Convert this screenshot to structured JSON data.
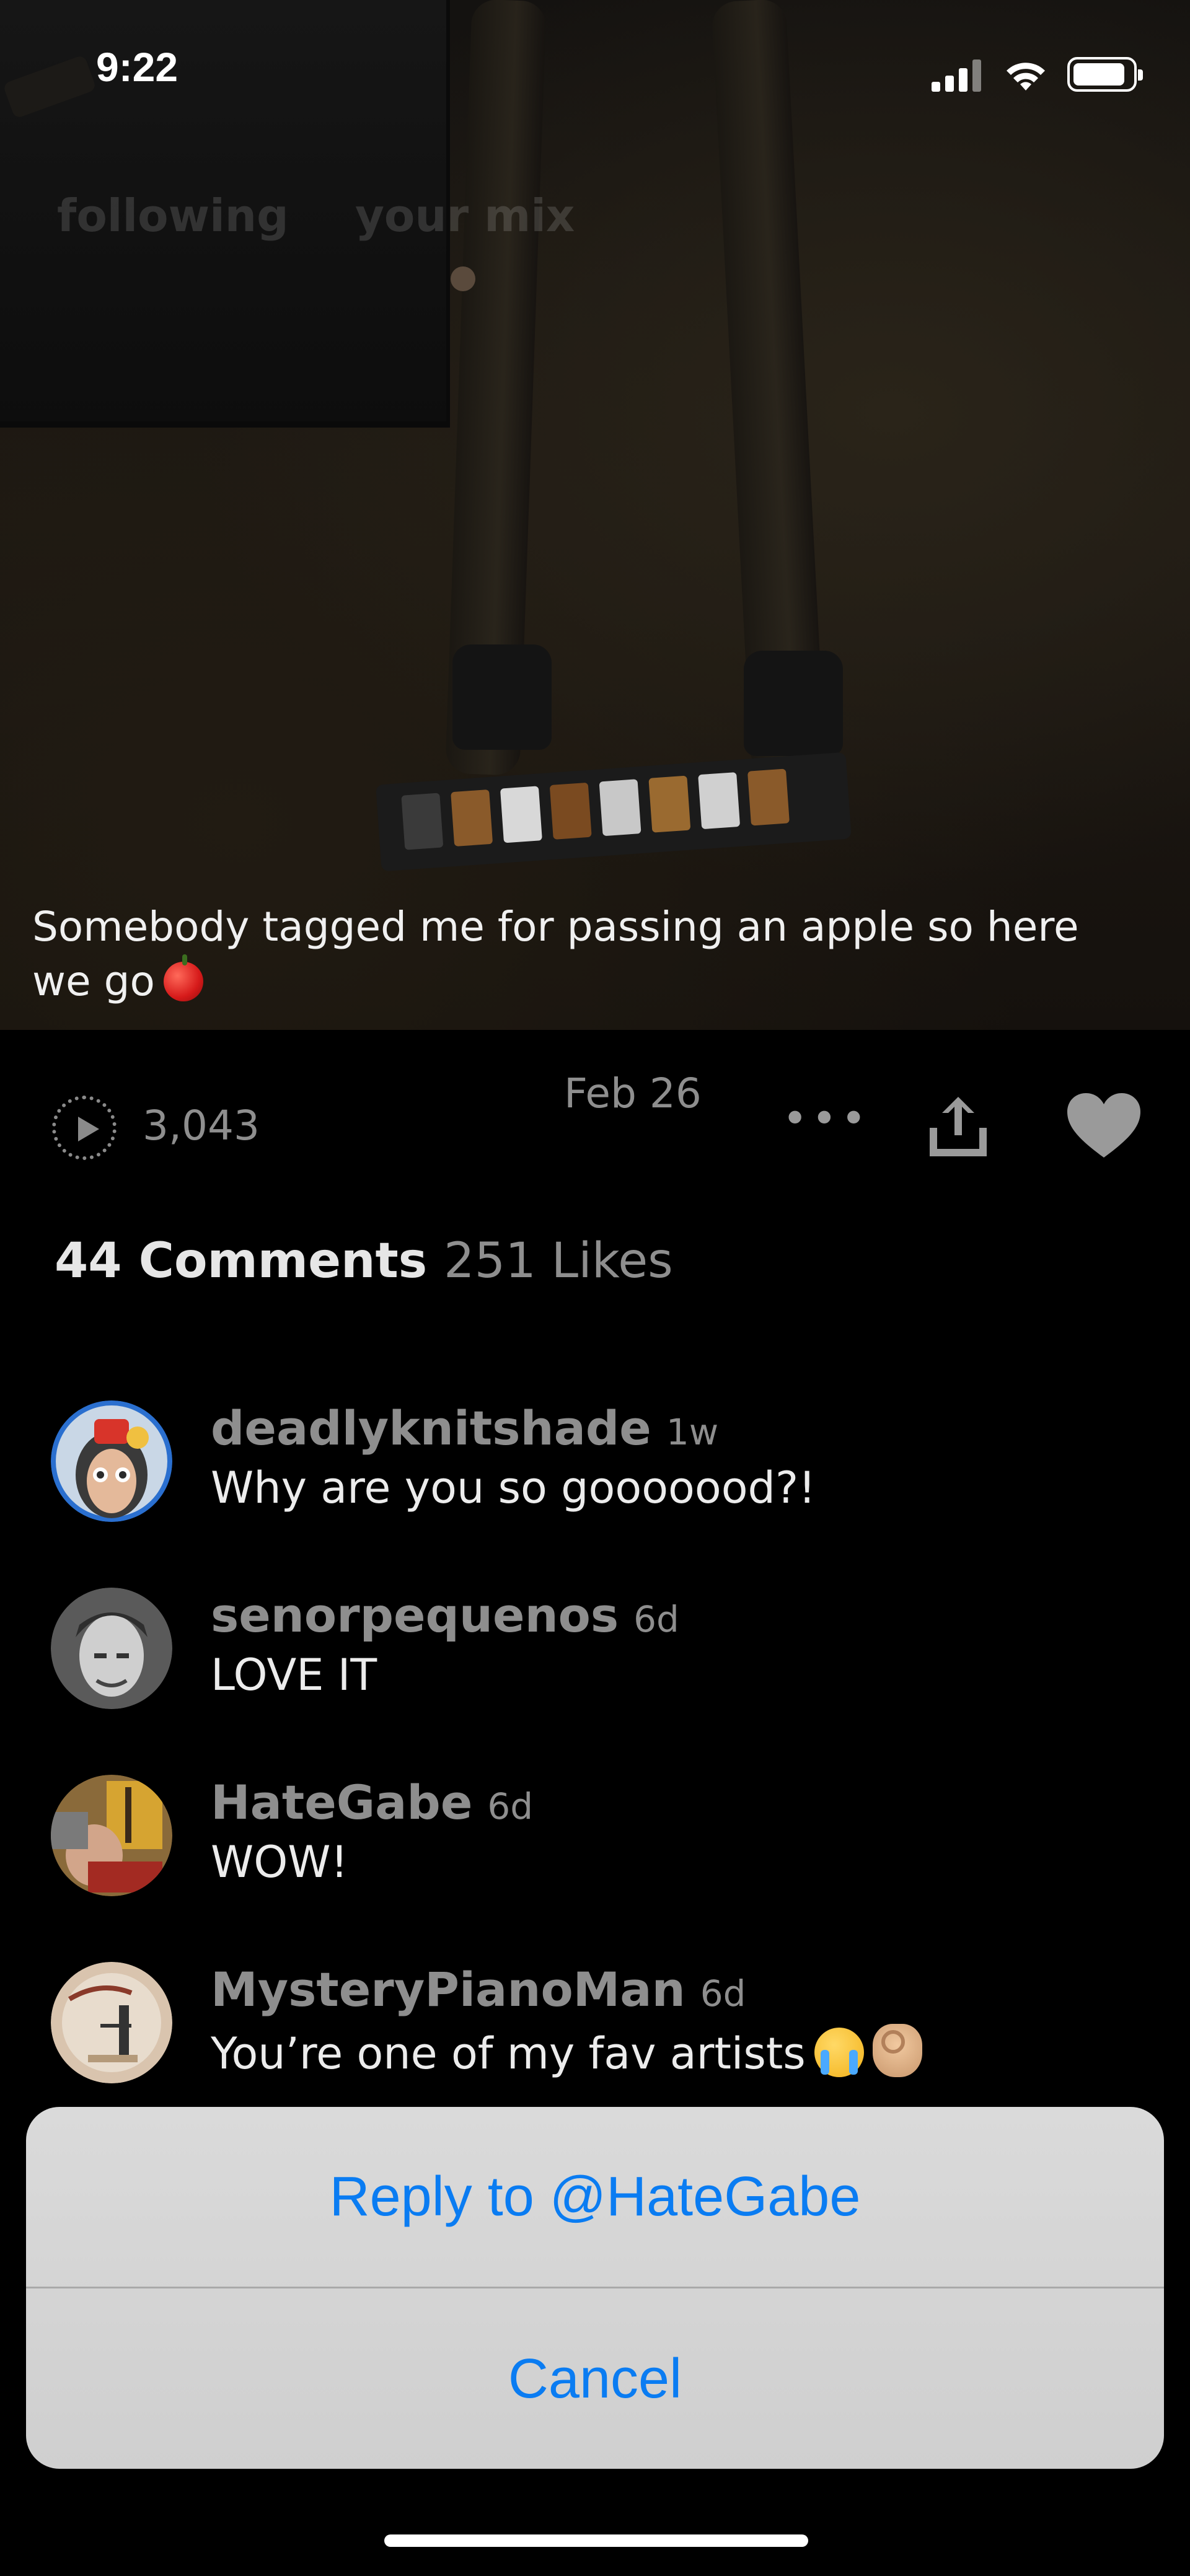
{
  "status_bar": {
    "time": "9:22"
  },
  "feed_tabs": {
    "following": "following",
    "your_mix": "your mix"
  },
  "post": {
    "caption": "Somebody tagged me for passing an apple so here we go",
    "caption_emoji": "apple-emoji",
    "plays": "3,043",
    "date": "Feb 26",
    "more_label": "•••"
  },
  "tabs": {
    "comments": "44 Comments",
    "likes": "251 Likes"
  },
  "comments": [
    {
      "user": "deadlyknitshade",
      "time": "1w",
      "text": "Why are you so gooooood?!"
    },
    {
      "user": "senorpequenos",
      "time": "6d",
      "text": "LOVE IT"
    },
    {
      "user": "HateGabe",
      "time": "6d",
      "text": "WOW!"
    },
    {
      "user": "MysteryPianoMan",
      "time": "6d",
      "text": "You’re one of my fav artists",
      "emojis": [
        "loudly-crying-face",
        "ok-hand"
      ]
    }
  ],
  "action_sheet": {
    "reply": "Reply to @HateGabe",
    "cancel": "Cancel"
  },
  "colors": {
    "accent": "#0a7cf2",
    "muted": "#8e8e8e",
    "background": "#000000"
  }
}
